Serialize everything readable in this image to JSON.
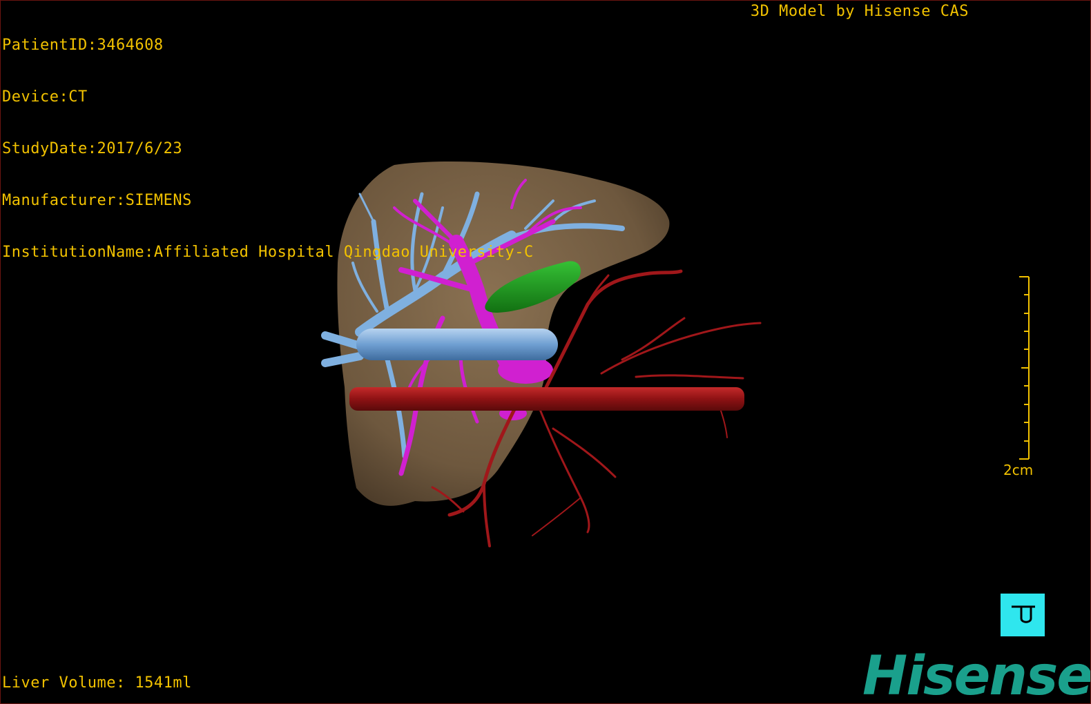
{
  "patient_info": {
    "patient_id": "PatientID:3464608",
    "device": "Device:CT",
    "study_date": "StudyDate:2017/6/23",
    "manufacturer": "Manufacturer:SIEMENS",
    "institution": "InstitutionName:Affiliated Hospital Qingdao University-C"
  },
  "model_credit": "3D Model by Hisense CAS",
  "volume_readout": "Liver Volume: 1541ml",
  "scale_bar": {
    "label": "2cm"
  },
  "view_button": {
    "icon": "view-cube-icon"
  },
  "brand": {
    "name": "Hisense"
  },
  "colors": {
    "overlay_text": "#f2c200",
    "liver": "#7a6347",
    "hepatic_vein": "#7fb0e0",
    "portal_vein": "#d020d0",
    "artery": "#a0171a",
    "gallbladder": "#22a022",
    "reset_button": "#2fe6ee",
    "brand": "#1aa08c"
  }
}
